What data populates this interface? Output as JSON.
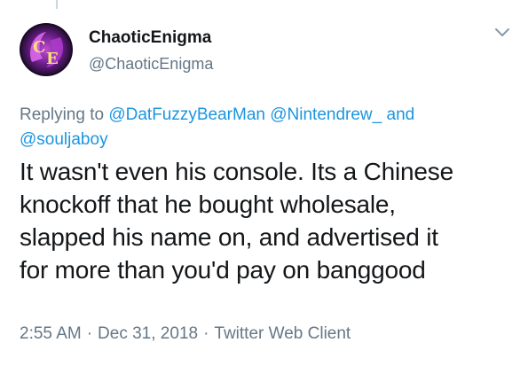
{
  "author": {
    "display_name": "ChaoticEnigma",
    "handle": "@ChaoticEnigma",
    "avatar_icon": "chaotic-enigma-logo"
  },
  "reply": {
    "prefix": "Replying to",
    "mentions": [
      "@DatFuzzyBearMan",
      "@Nintendrew_"
    ],
    "joiner": "and",
    "last_mention": "@souljaboy"
  },
  "tweet": {
    "lines": [
      "It wasn't even his console. Its a Chinese",
      "knockoff that he bought wholesale,",
      "slapped his name on, and advertised it",
      "for more than you'd pay on banggood"
    ]
  },
  "meta": {
    "time": "2:55 AM",
    "separator": "·",
    "date": "Dec 31, 2018",
    "client": "Twitter Web Client"
  },
  "colors": {
    "link": "#1b95e0",
    "secondary": "#657786",
    "text": "#14171a"
  }
}
